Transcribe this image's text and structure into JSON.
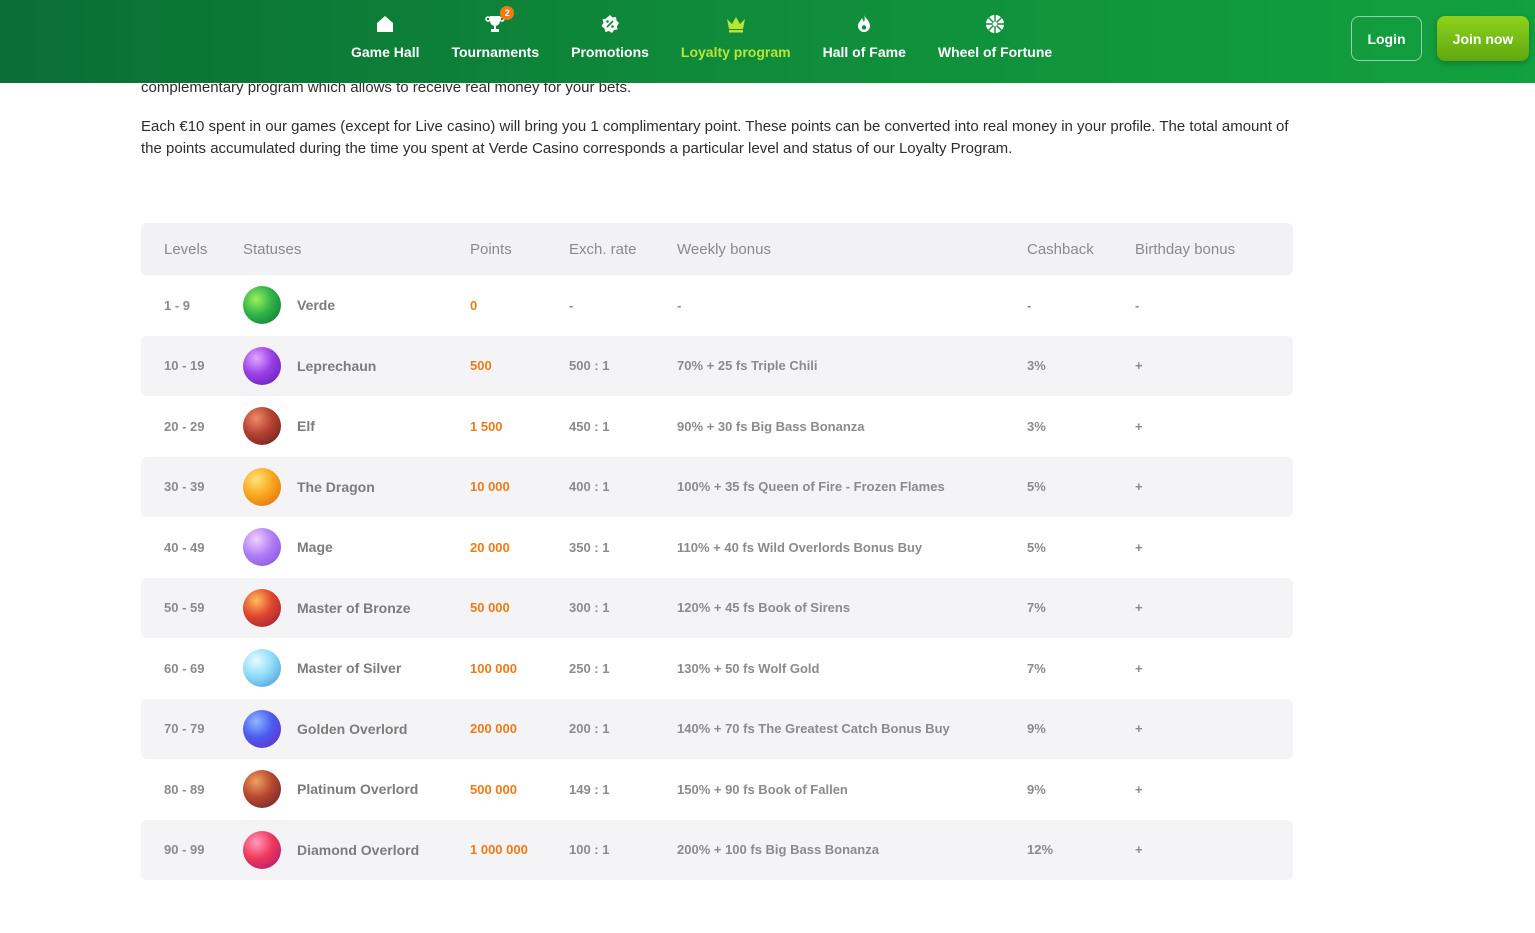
{
  "nav": {
    "items": [
      {
        "label": "Game Hall",
        "icon": "home-icon"
      },
      {
        "label": "Tournaments",
        "icon": "trophy-icon",
        "badge": "2"
      },
      {
        "label": "Promotions",
        "icon": "discount-icon"
      },
      {
        "label": "Loyalty program",
        "icon": "crown-icon"
      },
      {
        "label": "Hall of Fame",
        "icon": "flame-icon"
      },
      {
        "label": "Wheel of Fortune",
        "icon": "wheel-icon"
      }
    ],
    "login": "Login",
    "join": "Join now",
    "active_color": "#b8e636"
  },
  "intro": {
    "para1": "complementary program which allows to receive real money for your bets.",
    "para2": "Each €10 spent in our games (except for Live casino) will bring you 1 complimentary point. These points can be converted into real money in your profile. The total amount of the points accumulated during the time you spent at Verde Casino corresponds a particular level and status of our Loyalty Program."
  },
  "table": {
    "headers": [
      "Levels",
      "Statuses",
      "Points",
      "Exch. rate",
      "Weekly bonus",
      "Cashback",
      "Birthday bonus"
    ],
    "rows": [
      {
        "level": "1 - 9",
        "status": "Verde",
        "points": "0",
        "rate": "-",
        "weekly": "-",
        "cashback": "-",
        "birthday": "-"
      },
      {
        "level": "10 - 19",
        "status": "Leprechaun",
        "points": "500",
        "rate": "500 : 1",
        "weekly": "70% + 25 fs Triple Chili",
        "cashback": "3%",
        "birthday": "+"
      },
      {
        "level": "20 - 29",
        "status": "Elf",
        "points": "1 500",
        "rate": "450 : 1",
        "weekly": "90% + 30 fs Big Bass Bonanza",
        "cashback": "3%",
        "birthday": "+"
      },
      {
        "level": "30 - 39",
        "status": "The Dragon",
        "points": "10 000",
        "rate": "400 : 1",
        "weekly": "100% + 35 fs Queen of Fire - Frozen Flames",
        "cashback": "5%",
        "birthday": "+"
      },
      {
        "level": "40 - 49",
        "status": "Mage",
        "points": "20 000",
        "rate": "350 : 1",
        "weekly": "110% + 40 fs Wild Overlords Bonus Buy",
        "cashback": "5%",
        "birthday": "+"
      },
      {
        "level": "50 - 59",
        "status": "Master of Bronze",
        "points": "50 000",
        "rate": "300 : 1",
        "weekly": "120% + 45 fs Book of Sirens",
        "cashback": "7%",
        "birthday": "+"
      },
      {
        "level": "60 - 69",
        "status": "Master of Silver",
        "points": "100 000",
        "rate": "250 : 1",
        "weekly": "130% + 50 fs Wolf Gold",
        "cashback": "7%",
        "birthday": "+"
      },
      {
        "level": "70 - 79",
        "status": "Golden Overlord",
        "points": "200 000",
        "rate": "200 : 1",
        "weekly": "140% + 70 fs The Greatest Catch Bonus Buy",
        "cashback": "9%",
        "birthday": "+"
      },
      {
        "level": "80 - 89",
        "status": "Platinum Overlord",
        "points": "500 000",
        "rate": "149 : 1",
        "weekly": "150% + 90 fs Book of Fallen",
        "cashback": "9%",
        "birthday": "+"
      },
      {
        "level": "90 - 99",
        "status": "Diamond Overlord",
        "points": "1 000 000",
        "rate": "100 : 1",
        "weekly": "200% + 100 fs Big Bass Bonanza",
        "cashback": "12%",
        "birthday": "+"
      }
    ],
    "planet_icons": [
      "verde-planet-icon",
      "leprechaun-planet-icon",
      "elf-planet-icon",
      "dragon-planet-icon",
      "mage-planet-icon",
      "bronze-planet-icon",
      "silver-planet-icon",
      "golden-planet-icon",
      "platinum-planet-icon",
      "diamond-planet-icon"
    ],
    "points_color": "#f07a16"
  }
}
